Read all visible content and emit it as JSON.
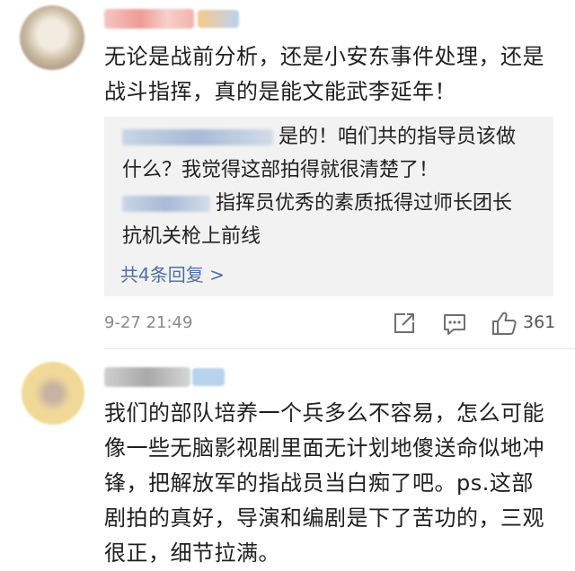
{
  "comments": [
    {
      "text_line1": "无论是战前分析，还是小安东事件处理，还是",
      "text_line2": "战斗指挥，真的是能文能武李延年！",
      "replies": [
        {
          "text_line1": "是的！咱们共的指导员该做",
          "text_line2": "什么？我觉得这部拍得就很清楚了！"
        },
        {
          "text_line1": "指挥员优秀的素质抵得过师长团长",
          "text_line2": "抗机关枪上前线"
        }
      ],
      "more_replies": "共4条回复 >",
      "timestamp": "9-27 21:49",
      "likes": "361"
    },
    {
      "text_lines": [
        "我们的部队培养一个兵多么不容易，怎么可能",
        "像一些无脑影视剧里面无计划地傻送命似地冲",
        "锋，把解放军的指战员当白痴了吧。ps.这部",
        "剧拍的真好，导演和编剧是下了苦功的，三观",
        "很正，细节拉满。"
      ]
    }
  ]
}
